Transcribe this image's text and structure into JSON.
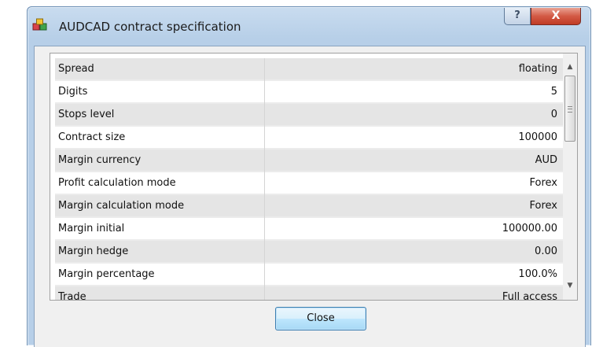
{
  "window": {
    "title": "AUDCAD contract specification",
    "help_glyph": "?",
    "close_glyph": "X",
    "app_icon": "cubes-icon"
  },
  "spec_rows": [
    {
      "label": "Spread",
      "value": "floating"
    },
    {
      "label": "Digits",
      "value": "5"
    },
    {
      "label": "Stops level",
      "value": "0"
    },
    {
      "label": "Contract size",
      "value": "100000"
    },
    {
      "label": "Margin currency",
      "value": "AUD"
    },
    {
      "label": "Profit calculation mode",
      "value": "Forex"
    },
    {
      "label": "Margin calculation mode",
      "value": "Forex"
    },
    {
      "label": "Margin initial",
      "value": "100000.00"
    },
    {
      "label": "Margin hedge",
      "value": "0.00"
    },
    {
      "label": "Margin percentage",
      "value": "100.0%"
    },
    {
      "label": "Trade",
      "value": "Full access"
    }
  ],
  "scrollbar": {
    "up_glyph": "▲",
    "down_glyph": "▼"
  },
  "footer": {
    "close_label": "Close"
  }
}
